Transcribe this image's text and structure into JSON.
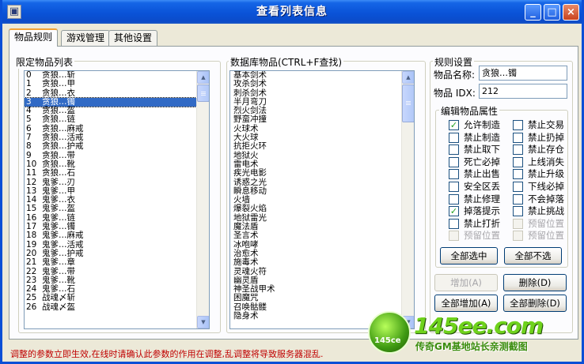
{
  "window": {
    "title": "查看列表信息",
    "buttons": {
      "minimize": "_",
      "maximize": "□",
      "close": "×"
    },
    "colors": {
      "titlebar": "#0a53d8",
      "selection": "#316ac5",
      "status_text": "#c00000"
    }
  },
  "tabs": [
    {
      "label": "物品规则",
      "active": true
    },
    {
      "label": "游戏管理",
      "active": false
    },
    {
      "label": "其他设置",
      "active": false
    }
  ],
  "limited_list": {
    "label": "限定物品列表",
    "selected_index": 3,
    "items": [
      {
        "idx": "0",
        "name": "贪狼…斩"
      },
      {
        "idx": "1",
        "name": "贪狼…甲"
      },
      {
        "idx": "2",
        "name": "贪狼…衣"
      },
      {
        "idx": "3",
        "name": "贪狼…镯"
      },
      {
        "idx": "4",
        "name": "贪狼…盔"
      },
      {
        "idx": "5",
        "name": "贪狼…链"
      },
      {
        "idx": "6",
        "name": "贪狼…麻戒"
      },
      {
        "idx": "7",
        "name": "贪狼…活戒"
      },
      {
        "idx": "8",
        "name": "贪狼…护戒"
      },
      {
        "idx": "9",
        "name": "贪狼…带"
      },
      {
        "idx": "10",
        "name": "贪狼…靴"
      },
      {
        "idx": "11",
        "name": "贪狼…石"
      },
      {
        "idx": "12",
        "name": "鬼爹…刃"
      },
      {
        "idx": "13",
        "name": "鬼爹…甲"
      },
      {
        "idx": "14",
        "name": "鬼爹…衣"
      },
      {
        "idx": "15",
        "name": "鬼爹…盔"
      },
      {
        "idx": "16",
        "name": "鬼爹…链"
      },
      {
        "idx": "17",
        "name": "鬼爹…镯"
      },
      {
        "idx": "18",
        "name": "鬼爹…麻戒"
      },
      {
        "idx": "19",
        "name": "鬼爹…活戒"
      },
      {
        "idx": "20",
        "name": "鬼爹…护戒"
      },
      {
        "idx": "21",
        "name": "鬼爹…章"
      },
      {
        "idx": "22",
        "name": "鬼爹…带"
      },
      {
        "idx": "23",
        "name": "鬼爹…靴"
      },
      {
        "idx": "24",
        "name": "鬼爹…石"
      },
      {
        "idx": "25",
        "name": "战魂〆斩"
      },
      {
        "idx": "26",
        "name": "战魂〆盔"
      }
    ],
    "scroll_fraction": 0
  },
  "db_list": {
    "label": "数据库物品(CTRL+F查找)",
    "items": [
      "基本剑术",
      "攻杀剑术",
      "刺杀剑术",
      "半月弯刀",
      "烈火剑法",
      "野蛮冲撞",
      "火球术",
      "大火球",
      "抗拒火环",
      "地狱火",
      "雷电术",
      "疾光电影",
      "诱惑之光",
      "瞬息移动",
      "火墙",
      "爆裂火焰",
      "地狱雷光",
      "魔法盾",
      "圣言术",
      "冰咆哮",
      "治愈术",
      "施毒术",
      "灵魂火符",
      "幽灵盾",
      "神圣战甲术",
      "困魔咒",
      "召唤骷髅",
      "隐身术"
    ],
    "scroll_fraction": 0
  },
  "rules": {
    "label": "规则设置",
    "name_label": "物品名称:",
    "name_value": "贪狼…镯",
    "idx_label": "物品 IDX:",
    "idx_value": "212"
  },
  "properties": {
    "label": "编辑物品属性",
    "left": [
      {
        "label": "允许制造",
        "checked": true,
        "enabled": true
      },
      {
        "label": "禁止制造",
        "checked": false,
        "enabled": true
      },
      {
        "label": "禁止取下",
        "checked": false,
        "enabled": true
      },
      {
        "label": "死亡必掉",
        "checked": false,
        "enabled": true
      },
      {
        "label": "禁止出售",
        "checked": false,
        "enabled": true
      },
      {
        "label": "安全区丢",
        "checked": false,
        "enabled": true
      },
      {
        "label": "禁止修理",
        "checked": false,
        "enabled": true
      },
      {
        "label": "掉落提示",
        "checked": true,
        "enabled": true
      },
      {
        "label": "禁止打折",
        "checked": false,
        "enabled": true
      },
      {
        "label": "预留位置",
        "checked": false,
        "enabled": false
      }
    ],
    "right": [
      {
        "label": "禁止交易",
        "checked": false,
        "enabled": true
      },
      {
        "label": "禁止扔掉",
        "checked": false,
        "enabled": true
      },
      {
        "label": "禁止存仓",
        "checked": false,
        "enabled": true
      },
      {
        "label": "上线消失",
        "checked": false,
        "enabled": true
      },
      {
        "label": "禁止升级",
        "checked": false,
        "enabled": true
      },
      {
        "label": "下线必掉",
        "checked": false,
        "enabled": true
      },
      {
        "label": "不会掉落",
        "checked": false,
        "enabled": true
      },
      {
        "label": "禁止挑战",
        "checked": false,
        "enabled": true
      },
      {
        "label": "预留位置",
        "checked": false,
        "enabled": false
      },
      {
        "label": "预留位置",
        "checked": false,
        "enabled": false
      }
    ],
    "select_all": "全部选中",
    "select_none": "全部不选"
  },
  "actions": {
    "add": "增加(A)",
    "delete": "删除(D)",
    "add_all": "全部增加(A)",
    "delete_all": "全部删除(D)"
  },
  "status": {
    "text": "调整的参数立即生效,在线时请确认此参数的作用在调整,乱调整将导致服务器混乱."
  },
  "watermark": {
    "disc_text": "145ce",
    "brand": "145ee.com",
    "slogan": "传奇GM基地站长亲测截图"
  }
}
